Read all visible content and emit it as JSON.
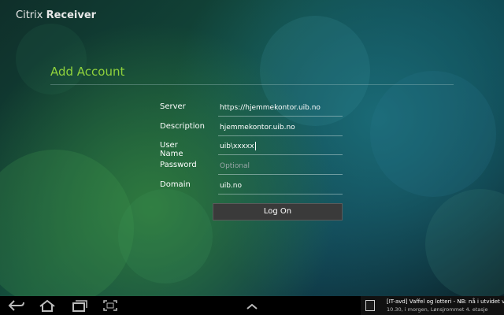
{
  "app": {
    "brand_prefix": "Citrix",
    "brand_name": "Receiver"
  },
  "form": {
    "heading": "Add Account",
    "server": {
      "label": "Server",
      "value": "https://hjemmekontor.uib.no"
    },
    "description": {
      "label": "Description",
      "value": "hjemmekontor.uib.no"
    },
    "username": {
      "label": "User Name",
      "value": "uib\\xxxxx"
    },
    "password": {
      "label": "Password",
      "placeholder": "Optional"
    },
    "domain": {
      "label": "Domain",
      "value": "uib.no"
    },
    "submit_label": "Log On"
  },
  "navbar": {
    "icons": [
      "back-icon",
      "home-icon",
      "recent-apps-icon",
      "screenshot-icon",
      "chevron-up-icon"
    ]
  },
  "notification": {
    "title": "[IT-avd] Vaffel og lotteri - NB: nå i utvidet vers",
    "subtitle": "10.30, i morgen, Lønsjrommet 4. etasje"
  },
  "colors": {
    "accent": "#8fd23c",
    "button": "#3a3a3a",
    "navbar": "#000000"
  }
}
